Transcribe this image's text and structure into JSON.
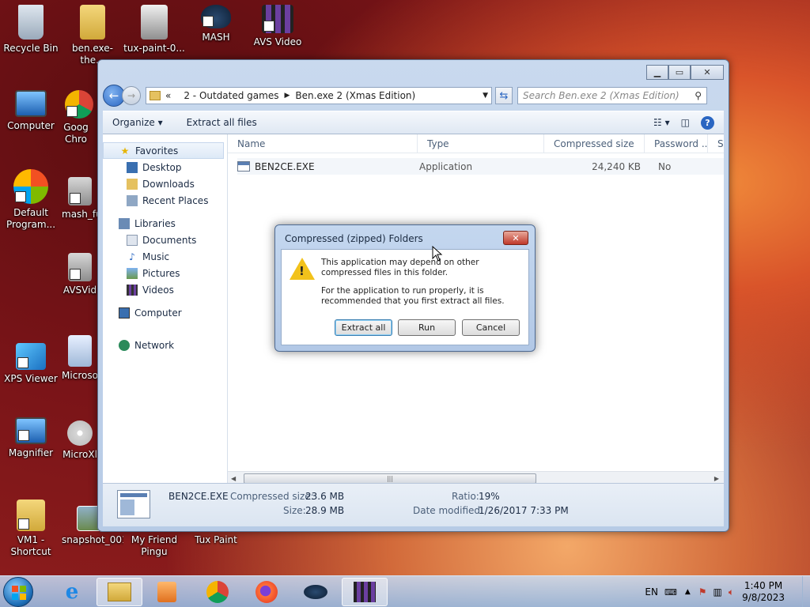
{
  "desktop": {
    "icons_left": [
      {
        "label": "Recycle Bin"
      },
      {
        "label": "Computer"
      },
      {
        "label": "Default Program..."
      },
      {
        "label": "XPS Viewer"
      },
      {
        "label": "Magnifier"
      },
      {
        "label": "VM1 - Shortcut"
      }
    ],
    "icons_col2": [
      {
        "label": "ben.exe-the..."
      },
      {
        "label": "Goog Chro"
      },
      {
        "label": "mash_fu"
      },
      {
        "label": "AVSVid"
      },
      {
        "label": "Microso"
      },
      {
        "label": "MicroXl"
      },
      {
        "label": "snapshot_001"
      }
    ],
    "icons_top": [
      {
        "label": "tux-paint-0..."
      },
      {
        "label": "MASH"
      },
      {
        "label": "AVS Video"
      }
    ],
    "icons_bottom": [
      {
        "label": "My Friend Pingu"
      },
      {
        "label": "Tux Paint"
      }
    ]
  },
  "explorer": {
    "address": {
      "prefix": "«",
      "segments": [
        "2 - Outdated games",
        "Ben.exe 2 (Xmas Edition)"
      ]
    },
    "search_placeholder": "Search Ben.exe 2 (Xmas Edition)",
    "toolbar": {
      "organize": "Organize",
      "extract": "Extract all files"
    },
    "nav": {
      "favorites": "Favorites",
      "favorites_items": [
        "Desktop",
        "Downloads",
        "Recent Places"
      ],
      "libraries": "Libraries",
      "libraries_items": [
        "Documents",
        "Music",
        "Pictures",
        "Videos"
      ],
      "computer": "Computer",
      "network": "Network"
    },
    "columns": [
      "Name",
      "Type",
      "Compressed size",
      "Password ...",
      "Si"
    ],
    "file": {
      "name": "BEN2CE.EXE",
      "type": "Application",
      "compressed_size": "24,240 KB",
      "password": "No"
    },
    "details": {
      "name": "BEN2CE.EXE",
      "compressed_label": "Compressed size:",
      "compressed_value": "23.6 MB",
      "size_label": "Size:",
      "size_value": "28.9 MB",
      "ratio_label": "Ratio:",
      "ratio_value": "19%",
      "date_label": "Date modified:",
      "date_value": "1/26/2017 7:33 PM"
    }
  },
  "dialog": {
    "title": "Compressed (zipped) Folders",
    "msg1": "This application may depend on other compressed files in this folder.",
    "msg2": "For the application to run properly, it is recommended that you first extract all files.",
    "buttons": {
      "extract": "Extract all",
      "run": "Run",
      "cancel": "Cancel"
    }
  },
  "tray": {
    "lang": "EN",
    "time": "1:40 PM",
    "date": "9/8/2023"
  }
}
